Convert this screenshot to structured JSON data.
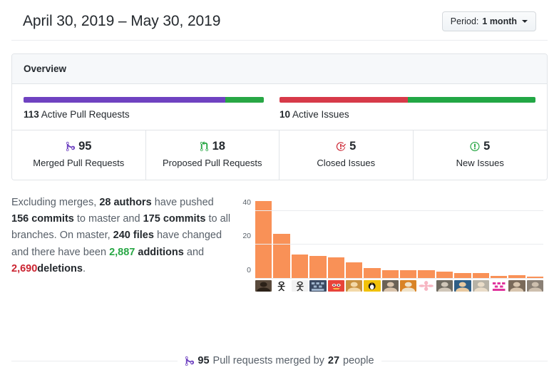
{
  "header": {
    "date_range": "April 30, 2019 – May 30, 2019",
    "period_prefix": "Period:",
    "period_value": "1 month",
    "caret_icon": "chevron-down-icon"
  },
  "overview": {
    "title": "Overview",
    "pull_requests": {
      "count": "113",
      "label": "Active Pull Requests",
      "merged_pct": 84,
      "proposed_pct": 16,
      "merged_color": "#6f42c1",
      "proposed_color": "#28a745"
    },
    "issues": {
      "count": "10",
      "label": "Active Issues",
      "closed_pct": 50,
      "new_pct": 50,
      "closed_color": "#d73a49",
      "new_color": "#22a745"
    },
    "stats": [
      {
        "icon": "git-merge-icon",
        "icon_color": "#6f42c1",
        "value": "95",
        "label": "Merged Pull Requests"
      },
      {
        "icon": "git-pull-request-icon",
        "icon_color": "#28a745",
        "value": "18",
        "label": "Proposed Pull Requests"
      },
      {
        "icon": "issue-closed-icon",
        "icon_color": "#cb2431",
        "value": "5",
        "label": "Closed Issues"
      },
      {
        "icon": "issue-opened-icon",
        "icon_color": "#28a745",
        "value": "5",
        "label": "New Issues"
      }
    ]
  },
  "summary": {
    "lead": "Excluding merges,",
    "authors": "28 authors",
    "have_pushed": "have pushed",
    "commits_master": "156 commits",
    "to_master_and": "to master and",
    "commits_all": "175 commits",
    "to_all_branches": "to all branches. On master,",
    "files": "240 files",
    "have_changed": "have changed and there have been",
    "additions": "2,887",
    "additions_word": "additions",
    "and_word": "and",
    "deletions": "2,690",
    "deletions_word": "deletions",
    "period": "."
  },
  "chart_data": {
    "type": "bar",
    "title": "",
    "xlabel": "",
    "ylabel": "",
    "categories": [
      "a1",
      "a2",
      "a3",
      "a4",
      "a5",
      "a6",
      "a7",
      "a8",
      "a9",
      "a10",
      "a11",
      "a12",
      "a13",
      "a14",
      "a15",
      "a16"
    ],
    "values": [
      46,
      26.5,
      14,
      13.5,
      12.5,
      9.5,
      6,
      5,
      5,
      5,
      4,
      3,
      3.2,
      1.7,
      1.8,
      1.2
    ],
    "ylim": [
      0,
      50
    ],
    "yticks": [
      0,
      20,
      40
    ],
    "ytick_labels": [
      "0",
      "20",
      "40"
    ],
    "grid": true,
    "legend": "none",
    "bar_color": "#f99157",
    "avatars": [
      "avatar-person-dark-jacket",
      "avatar-line-drawing-figure",
      "avatar-sketch-skeleton",
      "avatar-pixel-keyboard",
      "avatar-red-flame-monster",
      "avatar-golden-dog",
      "avatar-yellow-penguin",
      "avatar-man-glasses",
      "avatar-man-orange-bg",
      "avatar-pink-flower",
      "avatar-bearded-man",
      "avatar-woman-sunglasses",
      "avatar-woman-blonde",
      "avatar-pink-pixel-robot",
      "avatar-person-outdoors",
      "avatar-person-grey"
    ]
  },
  "footer": {
    "icon": "git-merge-icon",
    "icon_color": "#6f42c1",
    "count": "95",
    "text_mid": "Pull requests merged by",
    "people_count": "27",
    "people_word": "people"
  }
}
